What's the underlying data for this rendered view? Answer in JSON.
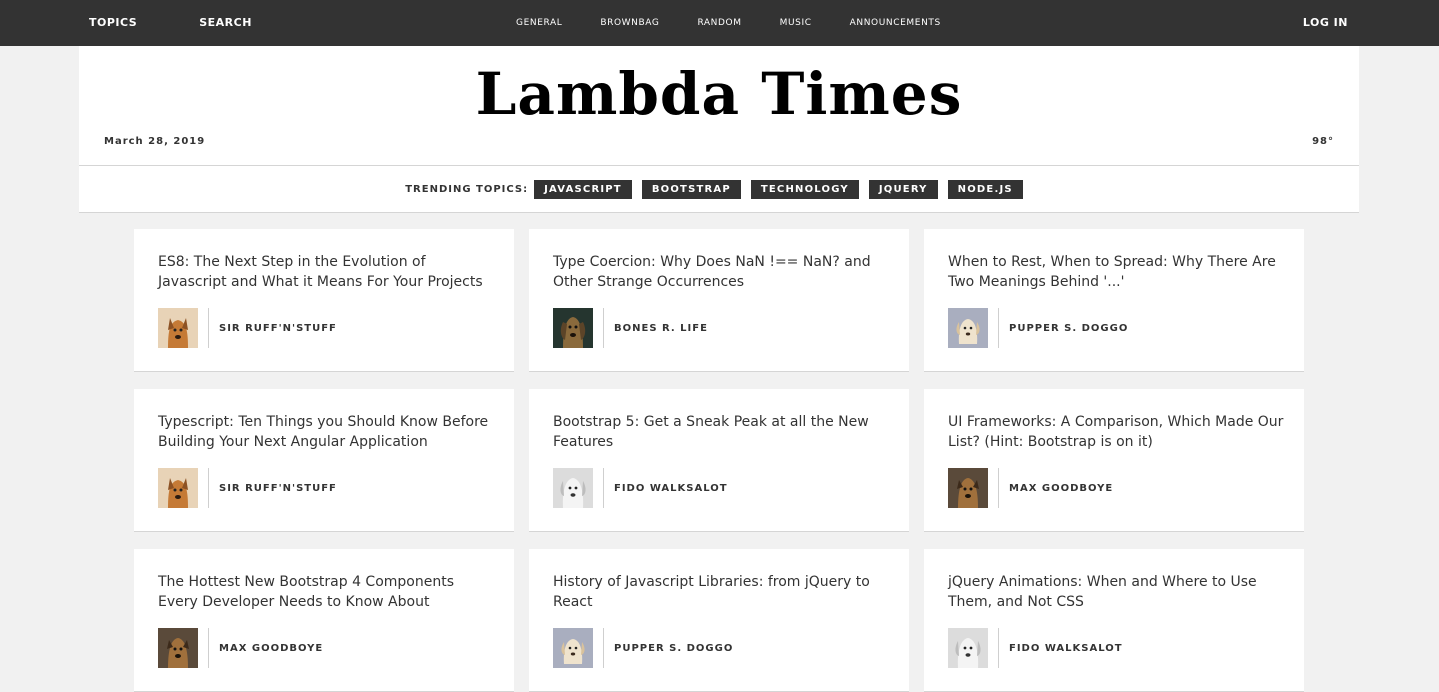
{
  "topbar": {
    "left": [
      "TOPICS",
      "SEARCH"
    ],
    "center": [
      "GENERAL",
      "BROWNBAG",
      "RANDOM",
      "MUSIC",
      "ANNOUNCEMENTS"
    ],
    "login": "LOG IN"
  },
  "header": {
    "title": "Lambda Times",
    "date": "March 28, 2019",
    "temp": "98°"
  },
  "trending": {
    "label": "TRENDING TOPICS:",
    "tags": [
      "JAVASCRIPT",
      "BOOTSTRAP",
      "TECHNOLOGY",
      "JQUERY",
      "NODE.JS"
    ]
  },
  "articles": [
    {
      "headline": "ES8: The Next Step in the Evolution of Javascript and What it Means For Your Projects",
      "author": "SIR RUFF'N'STUFF",
      "avatar": "orange-dog"
    },
    {
      "headline": "Type Coercion: Why Does NaN !== NaN? and Other Strange Occurrences",
      "author": "BONES R. LIFE",
      "avatar": "dark-dog"
    },
    {
      "headline": "When to Rest, When to Spread: Why There Are Two Meanings Behind '...'",
      "author": "PUPPER S. DOGGO",
      "avatar": "puppy"
    },
    {
      "headline": "Typescript: Ten Things you Should Know Before Building Your Next Angular Application",
      "author": "SIR RUFF'N'STUFF",
      "avatar": "orange-dog"
    },
    {
      "headline": "Bootstrap 5: Get a Sneak Peak at all the New Features",
      "author": "FIDO WALKSALOT",
      "avatar": "white-dog"
    },
    {
      "headline": "UI Frameworks: A Comparison, Which Made Our List? (Hint: Bootstrap is on it)",
      "author": "MAX GOODBOYE",
      "avatar": "brown-dog"
    },
    {
      "headline": "The Hottest New Bootstrap 4 Components Every Developer Needs to Know About",
      "author": "MAX GOODBOYE",
      "avatar": "brown-dog"
    },
    {
      "headline": "History of Javascript Libraries: from jQuery to React",
      "author": "PUPPER S. DOGGO",
      "avatar": "puppy"
    },
    {
      "headline": "jQuery Animations: When and Where to Use Them, and Not CSS",
      "author": "FIDO WALKSALOT",
      "avatar": "white-dog"
    }
  ],
  "colors": {
    "topbar_bg": "#333333",
    "page_bg": "#f1f1f1",
    "card_bg": "#ffffff",
    "tag_bg": "#333333"
  }
}
